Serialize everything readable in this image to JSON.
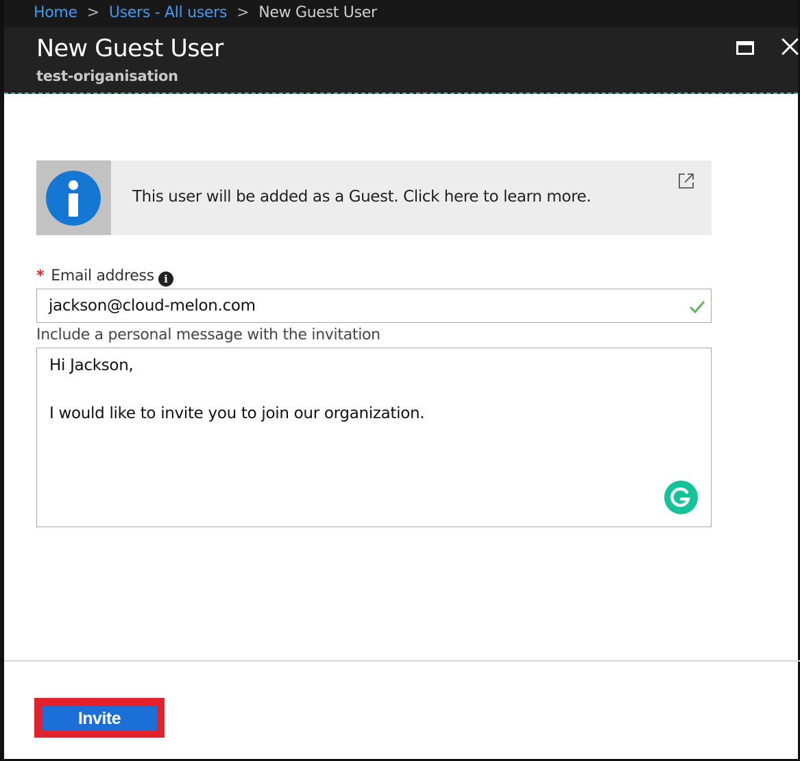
{
  "breadcrumb": {
    "items": [
      {
        "label": "Home"
      },
      {
        "label": "Users - All users"
      },
      {
        "label": "New Guest User"
      }
    ],
    "separator": ">"
  },
  "blade": {
    "title": "New Guest User",
    "subtitle": "test-origanisation",
    "maximize_icon": "maximize-icon",
    "close_icon": "close-icon"
  },
  "info_banner": {
    "icon": "info-icon",
    "text": "This user will be added as a Guest. Click here to learn more.",
    "link_icon": "external-link-icon"
  },
  "form": {
    "email": {
      "required_marker": "*",
      "label": "Email address",
      "info_icon_glyph": "i",
      "value": "jackson@cloud-melon.com",
      "status_icon": "check-icon"
    },
    "message": {
      "label": "Include a personal message with the invitation",
      "lines": [
        "Hi Jackson,",
        "",
        "I would like to invite you to join our organization."
      ],
      "extension_icon": "grammarly-icon"
    }
  },
  "footer": {
    "invite_label": "Invite"
  },
  "colors": {
    "header_bg": "#222222",
    "link": "#3e9bf0",
    "info_blue": "#1477d4",
    "check_green": "#5cb85c",
    "grammarly_green": "#15c39a",
    "button_blue": "#1d6fd8",
    "highlight_red": "#e4202b"
  }
}
